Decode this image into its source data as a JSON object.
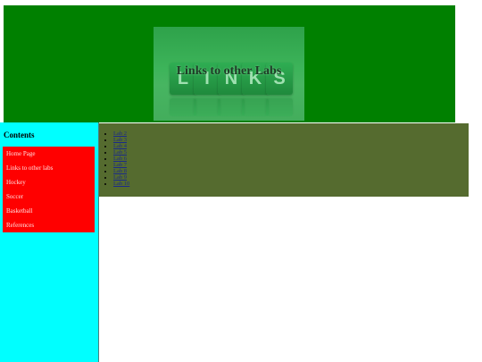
{
  "header": {
    "banner_title": "Links to other Labs",
    "banner_letters": [
      "L",
      "I",
      "N",
      "K",
      "S"
    ],
    "colors": {
      "header_bg": "#008000",
      "banner_bg": "#3db45a"
    }
  },
  "sidebar": {
    "heading": "Contents",
    "items": [
      {
        "label": "Home Page"
      },
      {
        "label": "Links to other labs"
      },
      {
        "label": "Hockey"
      },
      {
        "label": "Soccer"
      },
      {
        "label": "Basketball"
      },
      {
        "label": "References"
      }
    ],
    "colors": {
      "sidebar_bg": "#00ffff",
      "menu_bg": "#ff0000"
    }
  },
  "main": {
    "links": [
      {
        "label": "Lab 2"
      },
      {
        "label": "Lab 3"
      },
      {
        "label": "Lab 4"
      },
      {
        "label": "Lab 5"
      },
      {
        "label": "Lab 6"
      },
      {
        "label": "Lab 7"
      },
      {
        "label": "Lab 8"
      },
      {
        "label": "Lab 9"
      },
      {
        "label": "Lab 10"
      }
    ],
    "colors": {
      "content_bg": "#556b2f",
      "link": "#1a2a8a"
    }
  }
}
